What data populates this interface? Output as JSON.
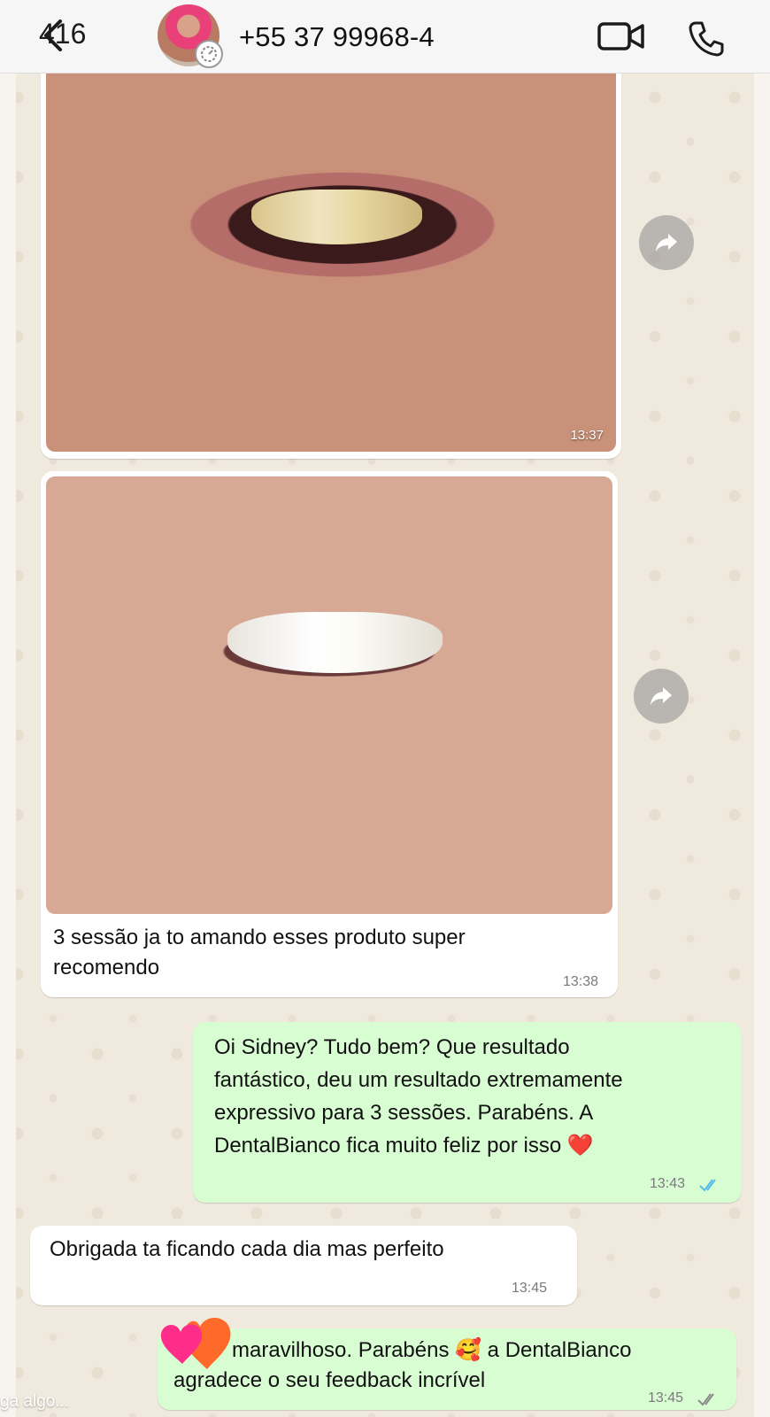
{
  "header": {
    "back_count": "416",
    "contact_name": "+55 37 99968-4"
  },
  "messages": [
    {
      "type": "image",
      "direction": "incoming",
      "time": "13:37"
    },
    {
      "type": "image",
      "direction": "incoming",
      "caption": [
        "3 sessão  ja to  amando esses produto super",
        "recomendo"
      ],
      "time": "13:38"
    },
    {
      "type": "text",
      "direction": "outgoing",
      "lines": [
        "Oi Sidney? Tudo bem? Que resultado",
        "fantástico, deu um resultado extremamente",
        "expressivo para 3 sessões. Parabéns. A",
        "DentalBianco fica muito feliz por isso ❤️"
      ],
      "time": "13:43",
      "status": "read"
    },
    {
      "type": "text",
      "direction": "incoming",
      "lines": [
        "Obrigada  ta ficando cada dia mas perfeito"
      ],
      "time": "13:45"
    },
    {
      "type": "text",
      "direction": "outgoing",
      "lines": [
        "maravilhoso. Parabéns 🥰 a DentalBianco",
        "agradece o seu feedback incrível"
      ],
      "time": "13:45",
      "status": "delivered"
    }
  ],
  "overlay": {
    "typing_hint": "ga algo..."
  },
  "colors": {
    "outgoing_bubble": "#d9fdd3",
    "incoming_bubble": "#ffffff",
    "read_ticks": "#53bdeb"
  },
  "icons": [
    "chevron-left-icon",
    "video-call-icon",
    "phone-icon",
    "forward-icon",
    "heart-reaction-icon",
    "status-icon"
  ]
}
